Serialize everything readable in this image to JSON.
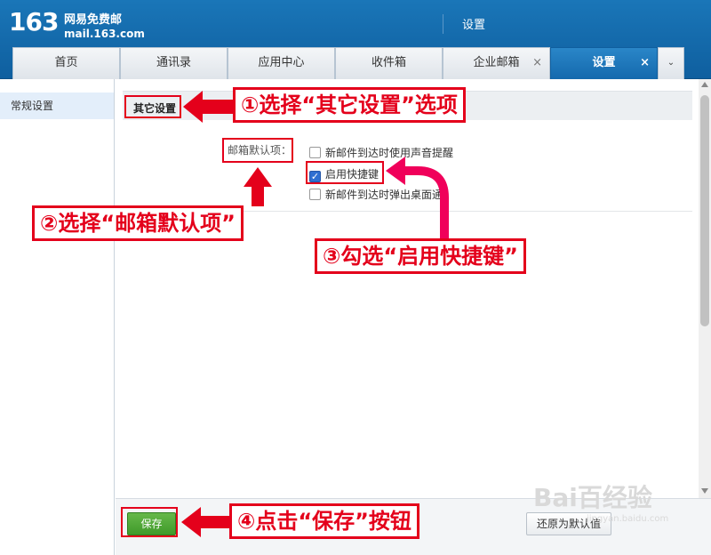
{
  "header": {
    "logo_num": "163",
    "logo_name": "网易免费邮",
    "logo_domain": "mail.163.com",
    "title": "设置"
  },
  "tabs": [
    {
      "label": "首页"
    },
    {
      "label": "通讯录"
    },
    {
      "label": "应用中心"
    },
    {
      "label": "收件箱"
    },
    {
      "label": "企业邮箱",
      "close": "×"
    },
    {
      "label": "设置",
      "close": "×",
      "active": true
    }
  ],
  "tab_more": "⌄",
  "sidebar": {
    "items": [
      {
        "label": "常规设置"
      }
    ]
  },
  "section": {
    "title": "其它设置",
    "field_label": "邮箱默认项：",
    "options": [
      {
        "label": "新邮件到达时使用声音提醒",
        "checked": false
      },
      {
        "label": "启用快捷键",
        "checked": true
      },
      {
        "label": "新邮件到达时弹出桌面通",
        "checked": false
      }
    ]
  },
  "footer": {
    "save_label": "保存",
    "restore_label": "还原为默认值"
  },
  "callouts": {
    "c1": "①选择“其它设置”选项",
    "c2": "②选择“邮箱默认项”",
    "c3": "③勾选“启用快捷键”",
    "c4": "④点击“保存”按钮"
  },
  "watermark": {
    "main": "Bai百经验",
    "sub": "jingyan.baidu.com"
  },
  "colors": {
    "brand": "#1469ad",
    "annotation": "#e4001b",
    "save": "#3f9a2a",
    "checkbox": "#2f6fd1"
  }
}
